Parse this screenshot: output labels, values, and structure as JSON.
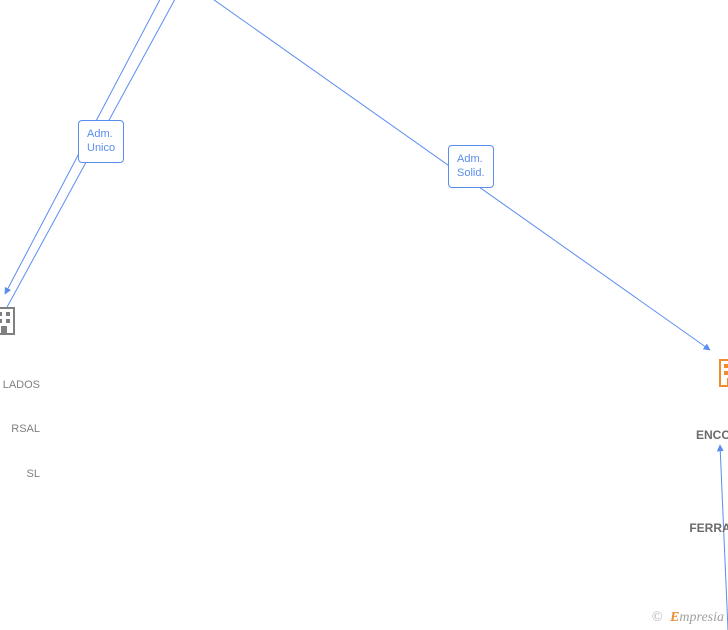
{
  "labels": {
    "adm_unico_line1": "Adm.",
    "adm_unico_line2": "Unico",
    "adm_solid_line1": "Adm.",
    "adm_solid_line2": "Solid."
  },
  "nodes": {
    "left_company_line1": "LADOS",
    "left_company_line2": "RSAL",
    "left_company_line3": " SL",
    "right_company_line1": "ENCOF",
    "right_company_line2": "FERRAL"
  },
  "watermark": {
    "copy": "©",
    "brand_e": "E",
    "brand_rest": "mpresia"
  },
  "colors": {
    "line": "#5b8def",
    "grey": "#808080",
    "orange": "#f08b2e"
  }
}
